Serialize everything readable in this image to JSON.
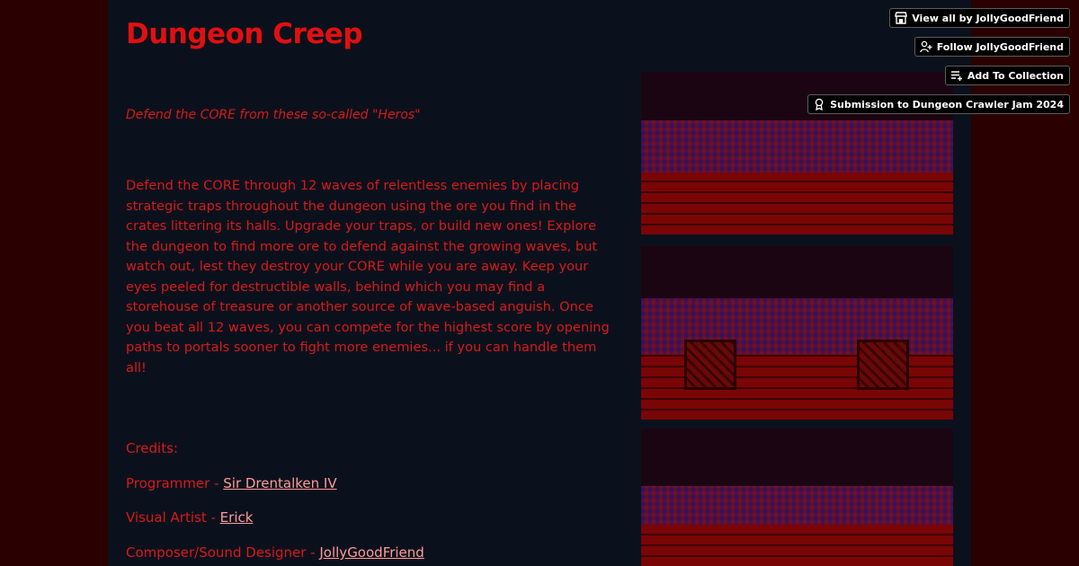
{
  "game": {
    "title": "Dungeon Creep",
    "tagline": "Defend the CORE from these so-called \"Heros\"",
    "description": "Defend the CORE through 12 waves of relentless enemies by placing strategic traps throughout the dungeon using the ore you find in the crates littering its halls. Upgrade your traps, or build new ones! Explore the dungeon to find more ore to defend against the growing waves, but watch out, lest they destroy your CORE while you are away. Keep your eyes peeled for destructible walls, behind which you may find a storehouse of treasure or another source of wave-based anguish. Once you beat all 12 waves, you can compete for the highest score by opening paths to portals sooner to fight more enemies... if you can handle them all!"
  },
  "credits": {
    "heading": "Credits:",
    "items": [
      {
        "role": "Programmer - ",
        "name": "Sir Drentalken IV"
      },
      {
        "role": "Visual Artist - ",
        "name": "Erick"
      },
      {
        "role": "Composer/Sound Designer - ",
        "name": "JollyGoodFriend"
      }
    ]
  },
  "actions": {
    "view_all": "View all by JollyGoodFriend",
    "follow": "Follow JollyGoodFriend",
    "add_collection": "Add To Collection",
    "submission": "Submission to Dungeon Crawler Jam 2024"
  },
  "icons": {
    "view_all": "storefront-icon",
    "follow": "user-plus-icon",
    "add_collection": "playlist-add-icon",
    "submission": "award-ribbon-icon"
  },
  "colors": {
    "background": "#2a0000",
    "column": "#0b111c",
    "text": "#d61a1a",
    "title": "#e01010",
    "link": "#ff9a9a"
  }
}
